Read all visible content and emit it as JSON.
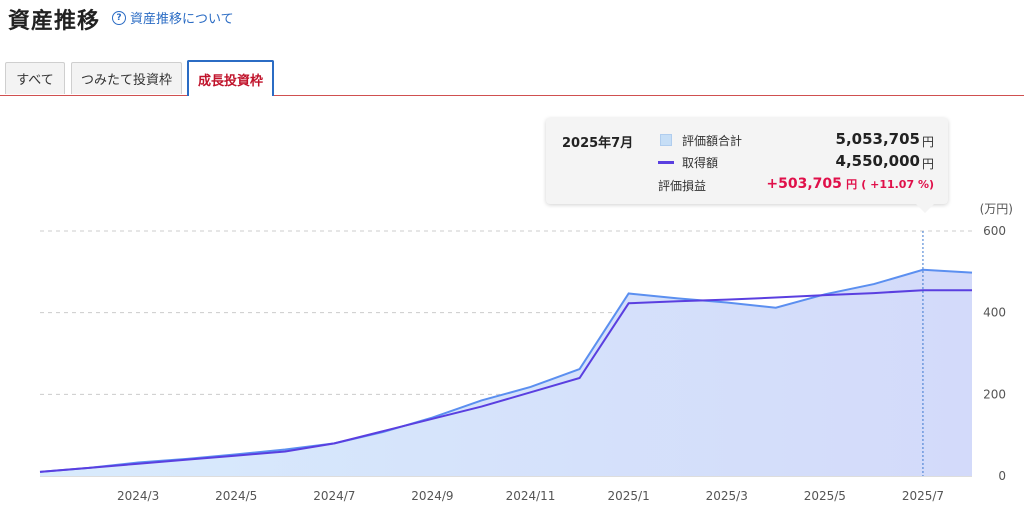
{
  "header": {
    "title": "資産推移",
    "help_icon": "?",
    "help_link": "資産推移について"
  },
  "tabs": [
    {
      "label": "すべて",
      "active": false
    },
    {
      "label": "つみたて投資枠",
      "active": false
    },
    {
      "label": "成長投資枠",
      "active": true
    }
  ],
  "tooltip": {
    "period": "2025年7月",
    "valuation_label": "評価額合計",
    "valuation_value": "5,053,705",
    "cost_label": "取得額",
    "cost_value": "4,550,000",
    "unit": "円",
    "pl_label": "評価損益",
    "pl_value": "+503,705",
    "pl_unit": "円",
    "pl_percent": "( +11.07 %)"
  },
  "colors": {
    "valuation_line": "#5b8ff0",
    "valuation_fill_top": "#cfe5fb",
    "valuation_fill_bottom": "#d5dcfa",
    "cost_line": "#5a3fe0",
    "accent_red": "#c0132b",
    "gain": "#e0104a"
  },
  "chart_data": {
    "type": "area",
    "ylabel": "(万円)",
    "ylim": [
      0,
      600
    ],
    "yticks": [
      0,
      200,
      400,
      600
    ],
    "x_tick_labels": [
      "2024/3",
      "2024/5",
      "2024/7",
      "2024/9",
      "2024/11",
      "2025/1",
      "2025/3",
      "2025/5",
      "2025/7"
    ],
    "x": [
      "2024/1",
      "2024/2",
      "2024/3",
      "2024/4",
      "2024/5",
      "2024/6",
      "2024/7",
      "2024/8",
      "2024/9",
      "2024/10",
      "2024/11",
      "2024/12",
      "2025/1",
      "2025/2",
      "2025/3",
      "2025/4",
      "2025/5",
      "2025/6",
      "2025/7",
      "2025/8"
    ],
    "series": [
      {
        "name": "評価額合計",
        "values": [
          10,
          20,
          33,
          42,
          53,
          65,
          80,
          108,
          143,
          185,
          218,
          262,
          447,
          435,
          425,
          412,
          445,
          470,
          505,
          498
        ]
      },
      {
        "name": "取得額",
        "values": [
          10,
          20,
          30,
          40,
          50,
          60,
          80,
          110,
          140,
          170,
          205,
          240,
          423,
          428,
          432,
          437,
          443,
          448,
          455,
          455
        ]
      }
    ],
    "highlight": "2025/7",
    "grid": true
  }
}
